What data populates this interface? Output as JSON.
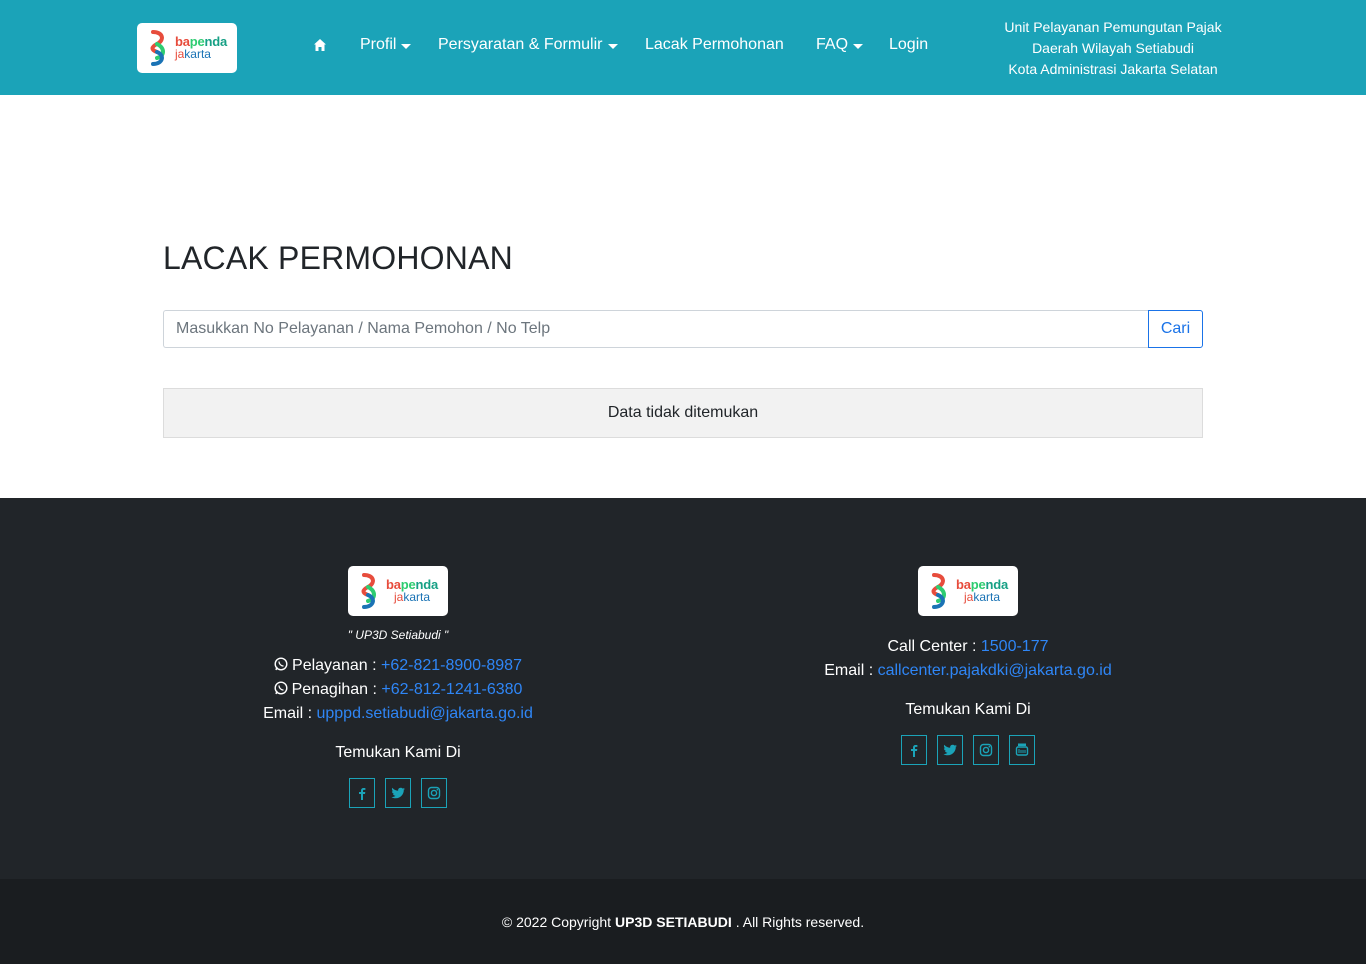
{
  "header": {
    "brand": {
      "line1_a": "ba",
      "line1_b": "pe",
      "line1_c": "nda",
      "line2_a": "ja",
      "line2_b": "karta"
    },
    "nav": [
      {
        "label": "",
        "icon": "home-icon"
      },
      {
        "label": "Profil",
        "dropdown": true
      },
      {
        "label": "Persyaratan & Formulir",
        "dropdown": true
      },
      {
        "label": "Lacak Permohonan",
        "dropdown": false
      },
      {
        "label": "FAQ",
        "dropdown": true
      },
      {
        "label": "Login",
        "dropdown": false
      }
    ],
    "unit_info": {
      "line1": "Unit Pelayanan Pemungutan Pajak",
      "line2": "Daerah Wilayah Setiabudi",
      "line3": "Kota Administrasi Jakarta Selatan"
    }
  },
  "main": {
    "title": "LACAK PERMOHONAN",
    "search": {
      "placeholder": "Masukkan No Pelayanan / Nama Pemohon / No Telp",
      "value": "",
      "button": "Cari"
    },
    "result_message": "Data tidak ditemukan"
  },
  "footer": {
    "left": {
      "tagline": "\" UP3D Setiabudi \"",
      "pelayanan_label": "Pelayanan : ",
      "pelayanan_phone": "+62-821-8900-8987",
      "penagihan_label": "Penagihan : ",
      "penagihan_phone": "+62-812-1241-6380",
      "email_label": "Email : ",
      "email": "upppd.setiabudi@jakarta.go.id",
      "find_us": "Temukan Kami Di",
      "socials": [
        "facebook-icon",
        "twitter-icon",
        "instagram-icon"
      ]
    },
    "right": {
      "callcenter_label": "Call Center : ",
      "callcenter": "1500-177",
      "email_label": "Email : ",
      "email": "callcenter.pajakdki@jakarta.go.id",
      "find_us": "Temukan Kami Di",
      "socials": [
        "facebook-icon",
        "twitter-icon",
        "instagram-icon",
        "youtube-icon"
      ]
    },
    "copyright_prefix": "© 2022 Copyright",
    "copyright_org": "UP3D SETIABUDI",
    "copyright_suffix": ". All Rights reserved."
  },
  "colors": {
    "accent": "#1ba3b8",
    "footer_bg": "#212529",
    "bottom_bg": "#1a1d20",
    "link": "#2f86f6"
  }
}
